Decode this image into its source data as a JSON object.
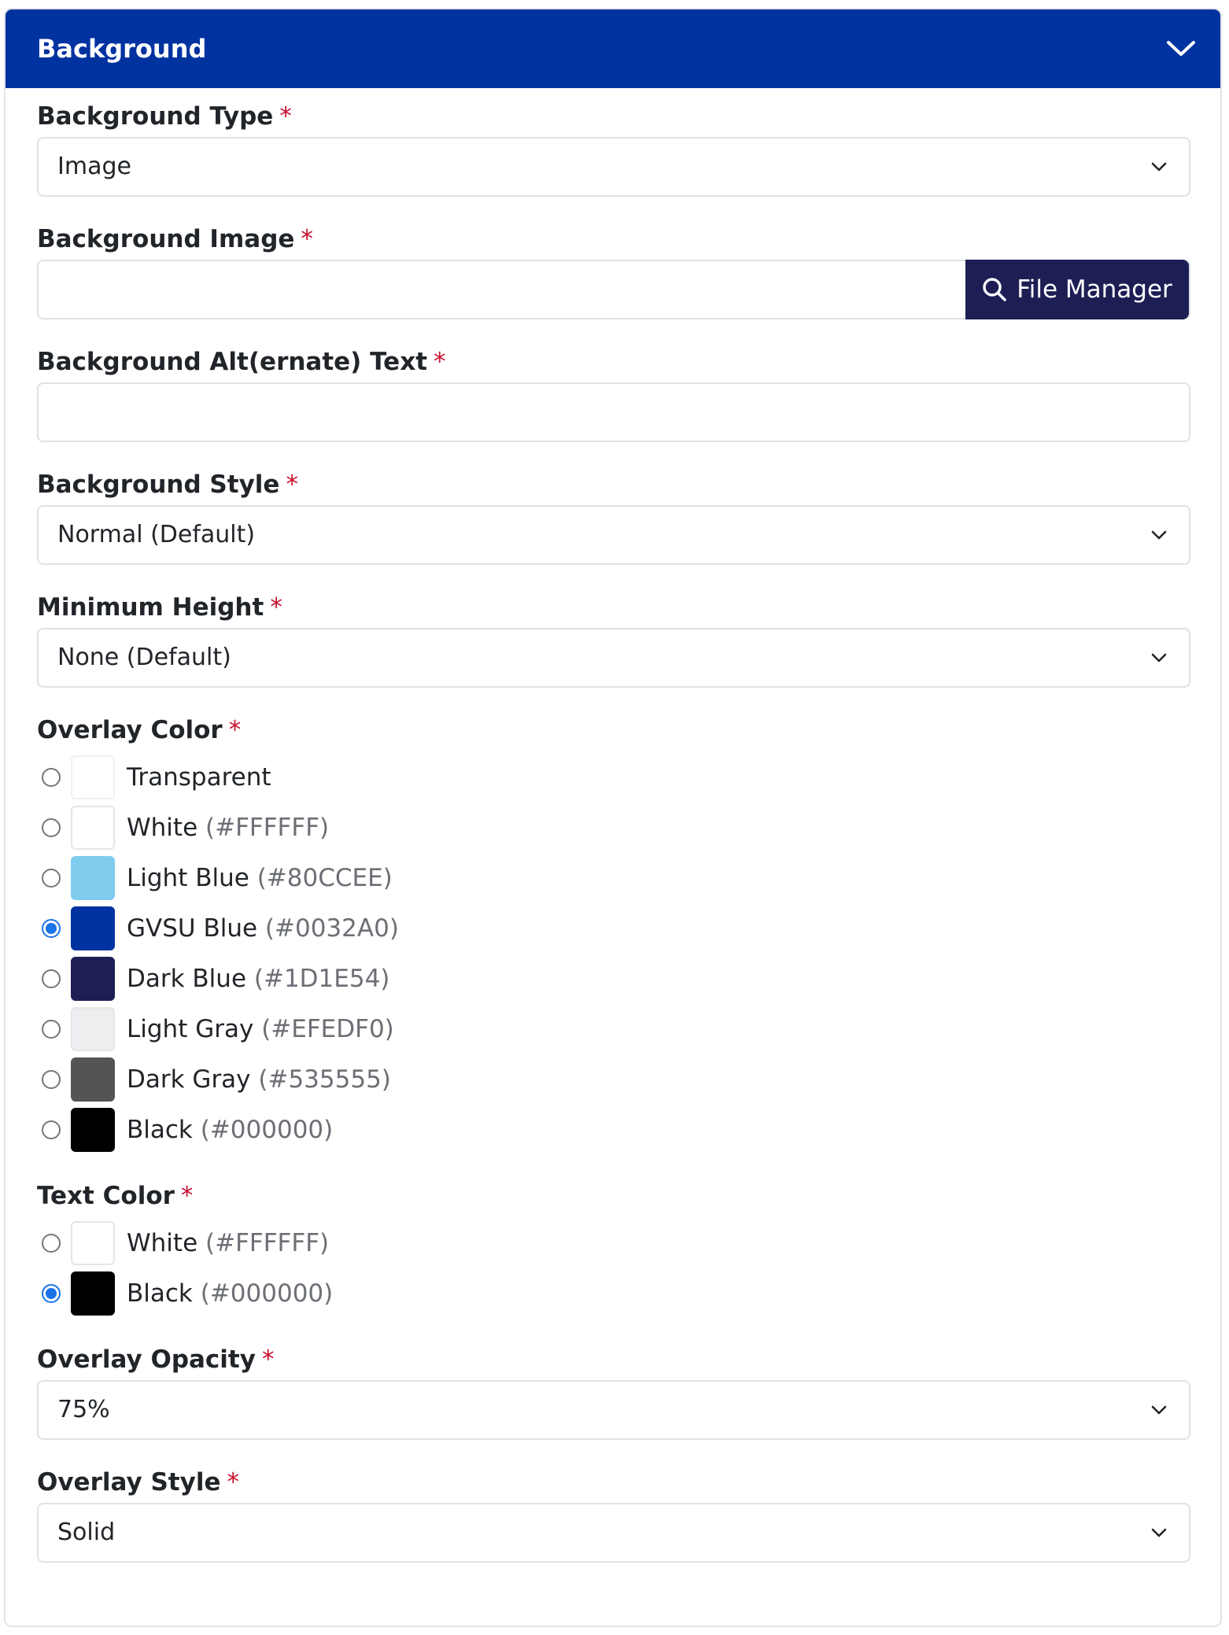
{
  "panel": {
    "title": "Background",
    "toggle_icon": "chevron-down-icon"
  },
  "required_mark": "*",
  "fields": {
    "background_type": {
      "label": "Background Type",
      "value": "Image"
    },
    "background_image": {
      "label": "Background Image",
      "value": "",
      "button_label": "File Manager",
      "button_icon": "search-icon"
    },
    "alt_text": {
      "label": "Background Alt(ernate) Text",
      "value": ""
    },
    "background_style": {
      "label": "Background Style",
      "value": "Normal (Default)"
    },
    "minimum_height": {
      "label": "Minimum Height",
      "value": "None (Default)"
    },
    "overlay_color": {
      "label": "Overlay Color",
      "options": [
        {
          "name": "Transparent",
          "hex": "",
          "color": "#ffffff",
          "transparent": true,
          "checked": false
        },
        {
          "name": "White",
          "hex": "(#FFFFFF)",
          "color": "#FFFFFF",
          "checked": false
        },
        {
          "name": "Light Blue",
          "hex": "(#80CCEE)",
          "color": "#80CCEE",
          "checked": false
        },
        {
          "name": "GVSU Blue",
          "hex": "(#0032A0)",
          "color": "#0032A0",
          "checked": true
        },
        {
          "name": "Dark Blue",
          "hex": "(#1D1E54)",
          "color": "#1D1E54",
          "checked": false
        },
        {
          "name": "Light Gray",
          "hex": "(#EFEDF0)",
          "color": "#EFEDF0",
          "checked": false
        },
        {
          "name": "Dark Gray",
          "hex": "(#535555)",
          "color": "#535555",
          "checked": false
        },
        {
          "name": "Black",
          "hex": "(#000000)",
          "color": "#000000",
          "checked": false
        }
      ]
    },
    "text_color": {
      "label": "Text Color",
      "options": [
        {
          "name": "White",
          "hex": "(#FFFFFF)",
          "color": "#FFFFFF",
          "checked": false
        },
        {
          "name": "Black",
          "hex": "(#000000)",
          "color": "#000000",
          "checked": true
        }
      ]
    },
    "overlay_opacity": {
      "label": "Overlay Opacity",
      "value": "75%"
    },
    "overlay_style": {
      "label": "Overlay Style",
      "value": "Solid"
    }
  },
  "colors": {
    "header": "#0032a0",
    "button": "#1d1e54",
    "required": "#c8102e",
    "radio_checked": "#1a73e8"
  }
}
